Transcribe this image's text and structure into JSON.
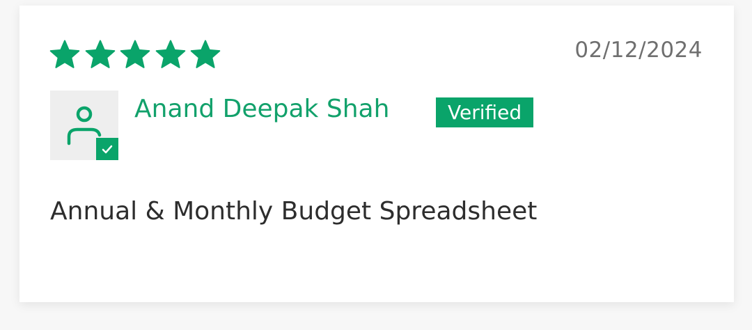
{
  "review": {
    "rating": 5,
    "rating_max": 5,
    "date": "02/12/2024",
    "reviewer": {
      "name": "Anand Deepak Shah",
      "badge": "Verified"
    },
    "title": "Annual & Monthly Budget Spreadsheet"
  },
  "icons": {
    "star": "star-icon",
    "avatar": "user-icon",
    "verified": "checkmark-icon"
  },
  "colors": {
    "accent": "#0aa46a",
    "name_text": "#12a16b",
    "date_text": "#6f6f6f",
    "body_text": "#2d2d2d",
    "avatar_bg": "#eeeeee"
  }
}
